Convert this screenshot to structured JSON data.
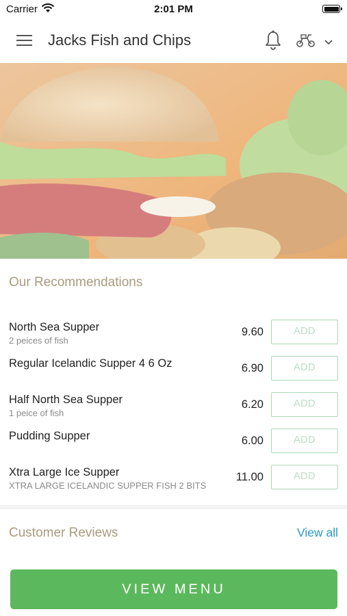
{
  "status_bar": {
    "carrier": "Carrier",
    "time": "2:01 PM"
  },
  "header": {
    "title": "Jacks Fish and Chips"
  },
  "recommendations": {
    "title": "Our Recommendations",
    "items": [
      {
        "name": "North Sea Supper",
        "description": "2 peices of fish",
        "price": "9.60",
        "button": "ADD"
      },
      {
        "name": "Regular Icelandic Supper 4 6 Oz",
        "description": "",
        "price": "6.90",
        "button": "ADD"
      },
      {
        "name": "Half North Sea Supper",
        "description": "1 peice of fish",
        "price": "6.20",
        "button": "ADD"
      },
      {
        "name": "Pudding Supper",
        "description": "",
        "price": "6.00",
        "button": "ADD"
      },
      {
        "name": "Xtra Large Ice Supper",
        "description": "XTRA LARGE ICELANDIC SUPPER FISH 2 BITS",
        "price": "11.00",
        "button": "ADD"
      }
    ]
  },
  "reviews": {
    "title": "Customer Reviews",
    "view_all": "View all"
  },
  "footer": {
    "view_menu": "VIEW MENU"
  },
  "icons": {
    "menu": "hamburger-menu-icon",
    "notifications": "bell-icon",
    "delivery": "scooter-icon",
    "dropdown": "chevron-down-icon",
    "wifi": "wifi-icon",
    "battery": "battery-icon"
  },
  "colors": {
    "accent_green": "#5cb85c",
    "section_title": "#a99a7d",
    "link_blue": "#2a98c7",
    "add_border": "#a9d8b6"
  }
}
